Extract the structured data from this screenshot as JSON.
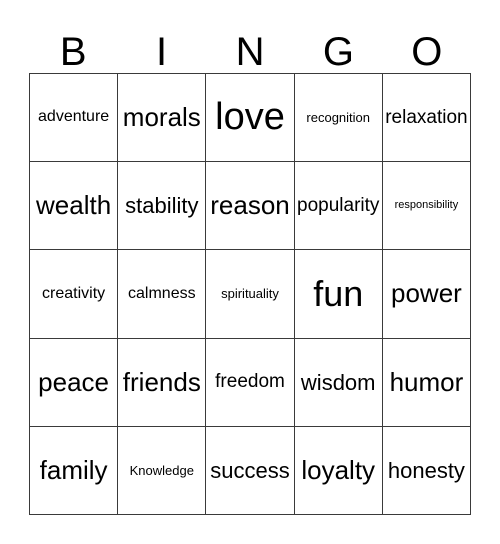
{
  "card": {
    "header_letters": [
      "B",
      "I",
      "N",
      "G",
      "O"
    ],
    "rows": [
      [
        {
          "text": "adventure",
          "size": "xs"
        },
        {
          "text": "morals",
          "size": "lg"
        },
        {
          "text": "love",
          "size": "xxl"
        },
        {
          "text": "recognition",
          "size": "xxs"
        },
        {
          "text": "relaxation",
          "size": "sm"
        }
      ],
      [
        {
          "text": "wealth",
          "size": "lg"
        },
        {
          "text": "stability",
          "size": "md"
        },
        {
          "text": "reason",
          "size": "lg"
        },
        {
          "text": "popularity",
          "size": "sm"
        },
        {
          "text": "responsibility",
          "size": "tiny"
        }
      ],
      [
        {
          "text": "creativity",
          "size": "xs"
        },
        {
          "text": "calmness",
          "size": "xs"
        },
        {
          "text": "spirituality",
          "size": "xxs"
        },
        {
          "text": "fun",
          "size": "xl"
        },
        {
          "text": "power",
          "size": "lg"
        }
      ],
      [
        {
          "text": "peace",
          "size": "lg"
        },
        {
          "text": "friends",
          "size": "lg"
        },
        {
          "text": "freedom",
          "size": "sm"
        },
        {
          "text": "wisdom",
          "size": "md"
        },
        {
          "text": "humor",
          "size": "lg"
        }
      ],
      [
        {
          "text": "family",
          "size": "lg"
        },
        {
          "text": "Knowledge",
          "size": "xxs"
        },
        {
          "text": "success",
          "size": "md"
        },
        {
          "text": "loyalty",
          "size": "lg"
        },
        {
          "text": "honesty",
          "size": "md"
        }
      ]
    ],
    "colors": {
      "background": "#ffffff",
      "text": "#000000",
      "grid_line": "#3a3a3a"
    }
  }
}
